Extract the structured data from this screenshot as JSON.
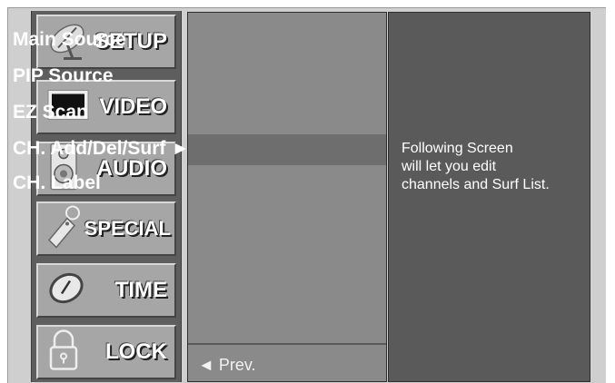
{
  "menu": {
    "categories": [
      {
        "label": "SETUP",
        "icon": "satellite-dish-icon"
      },
      {
        "label": "VIDEO",
        "icon": "tv-screen-icon"
      },
      {
        "label": "AUDIO",
        "icon": "speaker-icon"
      },
      {
        "label": "SPECIAL",
        "icon": "tag-icon"
      },
      {
        "label": "TIME",
        "icon": "clock-icon"
      },
      {
        "label": "LOCK",
        "icon": "padlock-icon"
      }
    ],
    "submenu": {
      "items": [
        "Main Source",
        "PIP Source",
        "EZ Scan",
        "CH. Add/Del/Surf ►",
        "CH. Label"
      ],
      "prev": "◄ Prev."
    },
    "description": {
      "line1": "Following Screen",
      "line2": "will let you edit",
      "line3": "channels and Surf List."
    }
  },
  "colors": {
    "left_column": "#5e5e5e",
    "category_button": "#a6a6a6",
    "submenu_panel": "#8a8a8a",
    "submenu_selected": "#6e6e6e",
    "description_panel": "#5a5a5a",
    "text": "#ffffff"
  }
}
